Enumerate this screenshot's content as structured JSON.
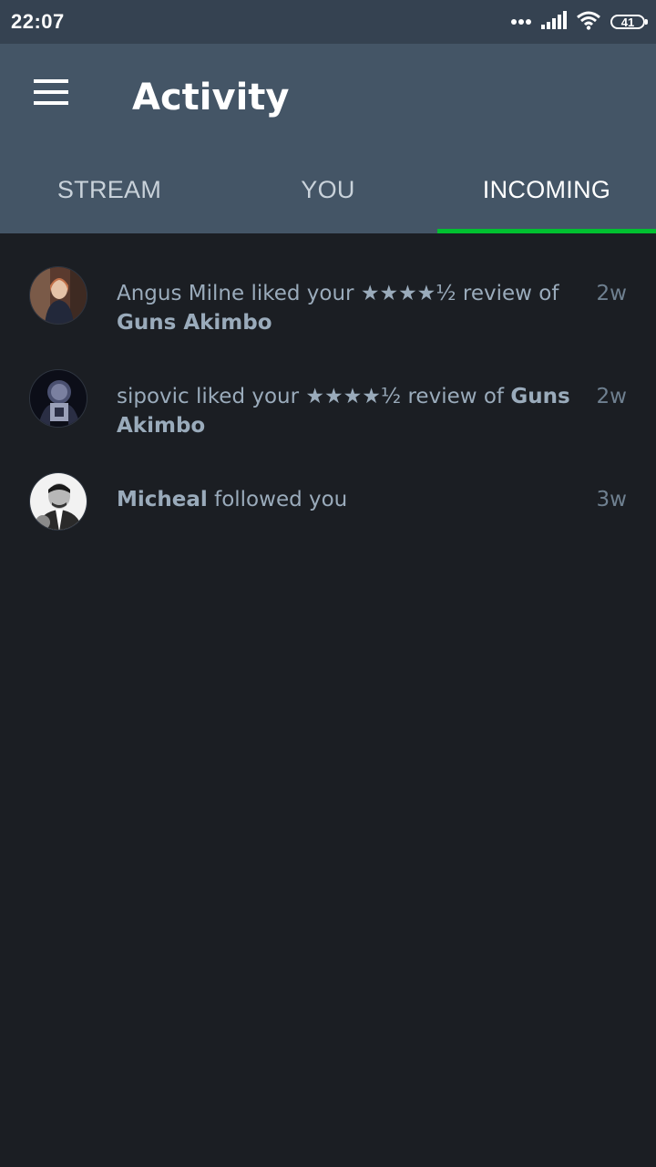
{
  "status_bar": {
    "time": "22:07",
    "battery": "41",
    "icons": [
      "more-dots-icon",
      "signal-icon",
      "wifi-icon",
      "battery-icon"
    ]
  },
  "header": {
    "title": "Activity",
    "menu_icon": "hamburger-menu-icon"
  },
  "tabs": [
    {
      "label": "STREAM",
      "active": false
    },
    {
      "label": "YOU",
      "active": false
    },
    {
      "label": "INCOMING",
      "active": true
    }
  ],
  "activity": [
    {
      "user": "Angus Milne",
      "action": "liked your",
      "rating": "★★★★½",
      "middle": "review of",
      "film": "Guns Akimbo",
      "time": "2w"
    },
    {
      "user": "sipovic",
      "action": "liked your",
      "rating": "★★★★½",
      "middle": "review of",
      "film": "Guns Akimbo",
      "time": "2w"
    },
    {
      "user": "Micheal",
      "action": "followed you",
      "time": "3w"
    }
  ],
  "colors": {
    "status_bar": "#354251",
    "app_bar": "#445566",
    "background": "#1b1e23",
    "accent": "#00c030",
    "text_secondary": "#9aabbb"
  }
}
